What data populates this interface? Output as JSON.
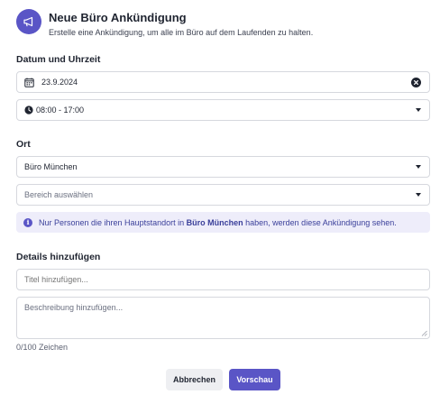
{
  "header": {
    "title": "Neue Büro Ankündigung",
    "subtitle": "Erstelle eine Ankündigung, um alle im Büro auf dem Laufenden zu halten."
  },
  "date_section": {
    "label": "Datum und Uhrzeit",
    "date_value": "23.9.2024",
    "time_value": "08:00 - 17:00"
  },
  "location_section": {
    "label": "Ort",
    "office_value": "Büro München",
    "area_placeholder": "Bereich auswählen",
    "info_prefix": "Nur Personen die ihren Hauptstandort in",
    "info_highlight": "Büro München",
    "info_suffix": "haben, werden diese Ankündigung sehen."
  },
  "details_section": {
    "label": "Details hinzufügen",
    "title_placeholder": "Titel hinzufügen...",
    "description_placeholder": "Beschreibung hinzufügen...",
    "char_counter": "0/100 Zeichen"
  },
  "actions": {
    "cancel_label": "Abbrechen",
    "preview_label": "Vorschau"
  },
  "colors": {
    "accent": "#5a55c6",
    "info_bg": "#eeedfa",
    "info_text": "#3a3f9a"
  },
  "icons": [
    "megaphone-icon",
    "calendar-icon",
    "clock-icon",
    "clear-icon",
    "chevron-down-icon",
    "info-icon"
  ]
}
